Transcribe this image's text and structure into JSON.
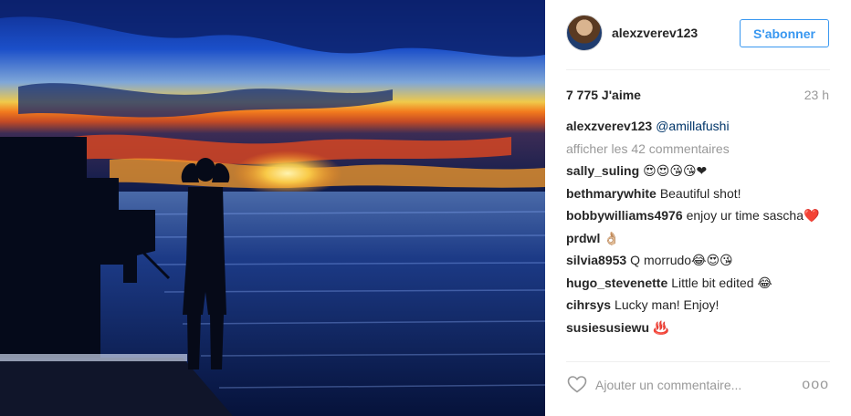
{
  "header": {
    "username": "alexzverev123",
    "follow_label": "S'abonner"
  },
  "stats": {
    "likes": "7 775 J'aime",
    "time": "23 h"
  },
  "caption": {
    "user": "alexzverev123",
    "mention": "@amillafushi"
  },
  "show_all_comments": "afficher les 42 commentaires",
  "comments": [
    {
      "user": "sally_suling",
      "text": "😍😍😘😘❤"
    },
    {
      "user": "bethmarywhite",
      "text": "Beautiful shot!"
    },
    {
      "user": "bobbywilliams4976",
      "text": "enjoy ur time sascha❤️"
    },
    {
      "user": "prdwl",
      "text": "👌🏼"
    },
    {
      "user": "silvia8953",
      "text": "Q morrudo😂😍😘"
    },
    {
      "user": "hugo_stevenette",
      "text": "Little bit edited 😂"
    },
    {
      "user": "cihrsys",
      "text": "Lucky man! Enjoy!"
    },
    {
      "user": "susiesusiewu",
      "text": "♨️"
    }
  ],
  "footer": {
    "comment_placeholder": "Ajouter un commentaire...",
    "more_label": "ooo"
  },
  "icons": {
    "like": "heart-icon",
    "more": "more-options-icon"
  },
  "colors": {
    "accent": "#3897f0",
    "mention": "#003569",
    "muted": "#999999"
  }
}
